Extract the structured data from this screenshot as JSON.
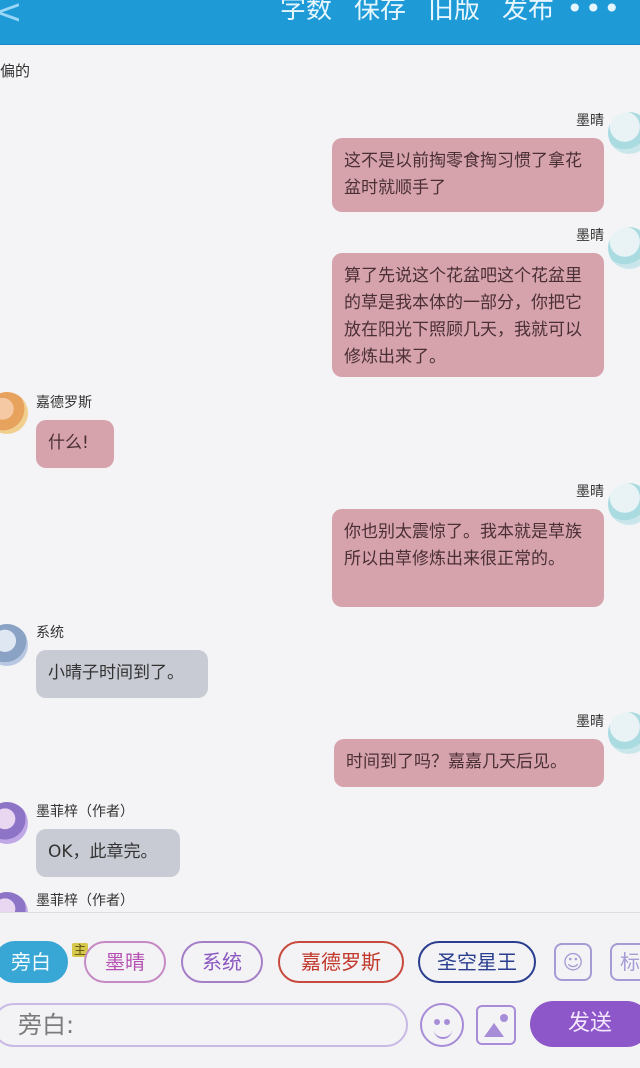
{
  "topbar": {
    "back_symbol": "<",
    "actions": [
      "字数",
      "保存",
      "旧版",
      "发布"
    ],
    "more_symbol": "•••"
  },
  "chat": {
    "partial_text": "偏的",
    "messages": [
      {
        "side": "right",
        "name": "墨晴",
        "text": "这不是以前掏零食掏习惯了拿花盆时就顺手了"
      },
      {
        "side": "right",
        "name": "墨晴",
        "text": "算了先说这个花盆吧这个花盆里的草是我本体的一部分，你把它放在阳光下照顾几天，我就可以修炼出来了。"
      },
      {
        "side": "left",
        "name": "嘉德罗斯",
        "text": "什么!"
      },
      {
        "side": "right",
        "name": "墨晴",
        "text": "你也别太震惊了。我本就是草族所以由草修炼出来很正常的。"
      },
      {
        "side": "left",
        "name": "系统",
        "text": "小晴子时间到了。"
      },
      {
        "side": "right",
        "name": "墨晴",
        "text": "时间到了吗？嘉嘉几天后见。"
      },
      {
        "side": "left",
        "name": "墨菲梓（作者）",
        "text": "OK，此章完。"
      },
      {
        "side": "left",
        "name": "墨菲梓（作者）",
        "text": ""
      }
    ]
  },
  "roles": {
    "items": [
      "旁白",
      "墨晴",
      "系统",
      "嘉德罗斯",
      "圣空星王"
    ],
    "badge": "主",
    "extra_icons": [
      "person-icon",
      "tag-icon"
    ],
    "tag_label": "标"
  },
  "composer": {
    "input_placeholder": "旁白:",
    "send_label": "发送"
  },
  "colors": {
    "topbar": "#1e9ad7",
    "bubble_pink": "#d6a3ad",
    "bubble_gray": "#c8cbd3",
    "send": "#8e57c9",
    "active_role": "#39a7d5"
  }
}
